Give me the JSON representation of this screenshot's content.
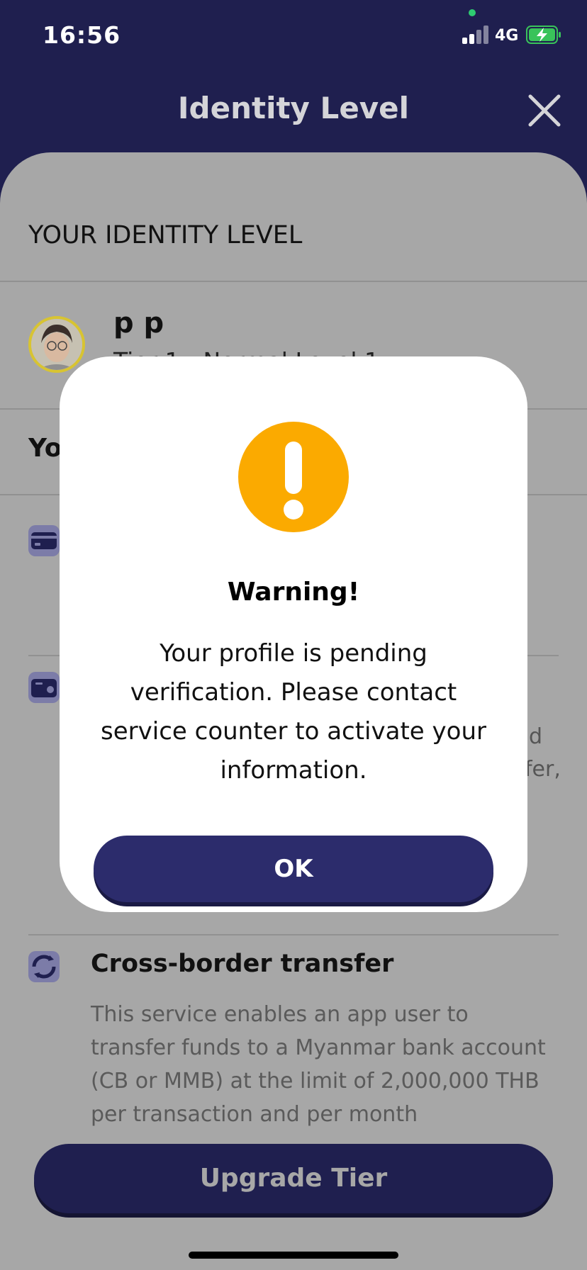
{
  "status_bar": {
    "time": "16:56",
    "network": "4G"
  },
  "header": {
    "title": "Identity Level"
  },
  "identity": {
    "section_title": "YOUR IDENTITY LEVEL",
    "user_name": "p p",
    "user_tier": "Tier 1 - Normal Level 1",
    "your_label": "Yo"
  },
  "services": {
    "fragment_1": "d",
    "fragment_2": "fer,",
    "item": {
      "title": "Cross-border transfer",
      "description": "This service enables an app user to transfer funds to a Myanmar bank account (CB or MMB) at the limit of 2,000,000 THB per transaction and per month"
    }
  },
  "upgrade_button": {
    "label": "Upgrade Tier"
  },
  "modal": {
    "title": "Warning!",
    "message": "Your profile is pending verification. Please contact service counter to activate your information.",
    "ok_label": "OK"
  },
  "colors": {
    "header_bg": "#1f1f4f",
    "overlay_bg": "#a7a7a7",
    "warning": "#fbaa00",
    "button": "#2c2c6c"
  },
  "icons": [
    "signal-icon",
    "battery-charging-icon",
    "close-icon",
    "avatar",
    "card-icon",
    "wallet-icon",
    "cross-border-transfer-icon",
    "warning-icon"
  ]
}
